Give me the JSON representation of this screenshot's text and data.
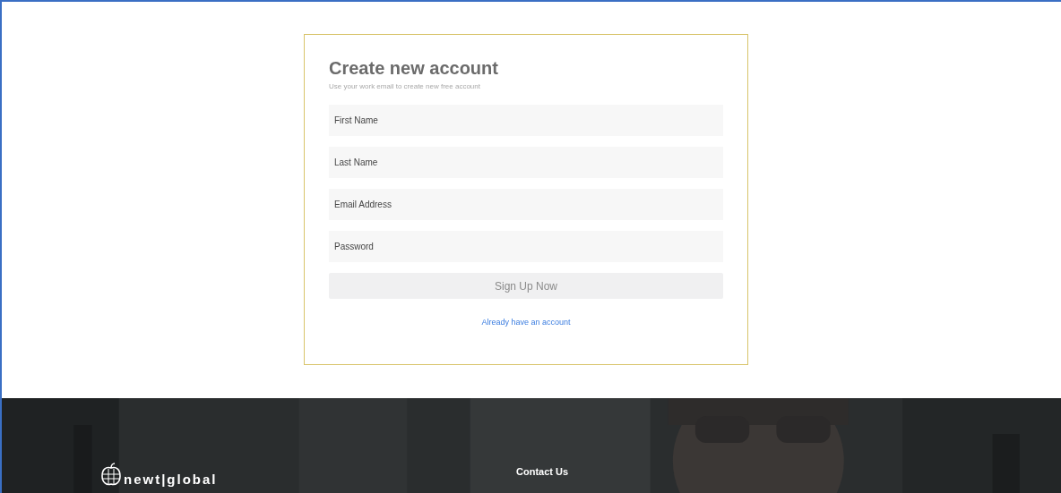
{
  "form": {
    "title": "Create new account",
    "subtitle": "Use your work email to create new free account",
    "fields": [
      {
        "placeholder": "First Name"
      },
      {
        "placeholder": "Last Name"
      },
      {
        "placeholder": "Email Address"
      },
      {
        "placeholder": "Password"
      }
    ],
    "submit": "Sign Up Now",
    "link": "Already have an account"
  },
  "footer": {
    "logo": "newt|global",
    "heading": "Contact Us"
  }
}
